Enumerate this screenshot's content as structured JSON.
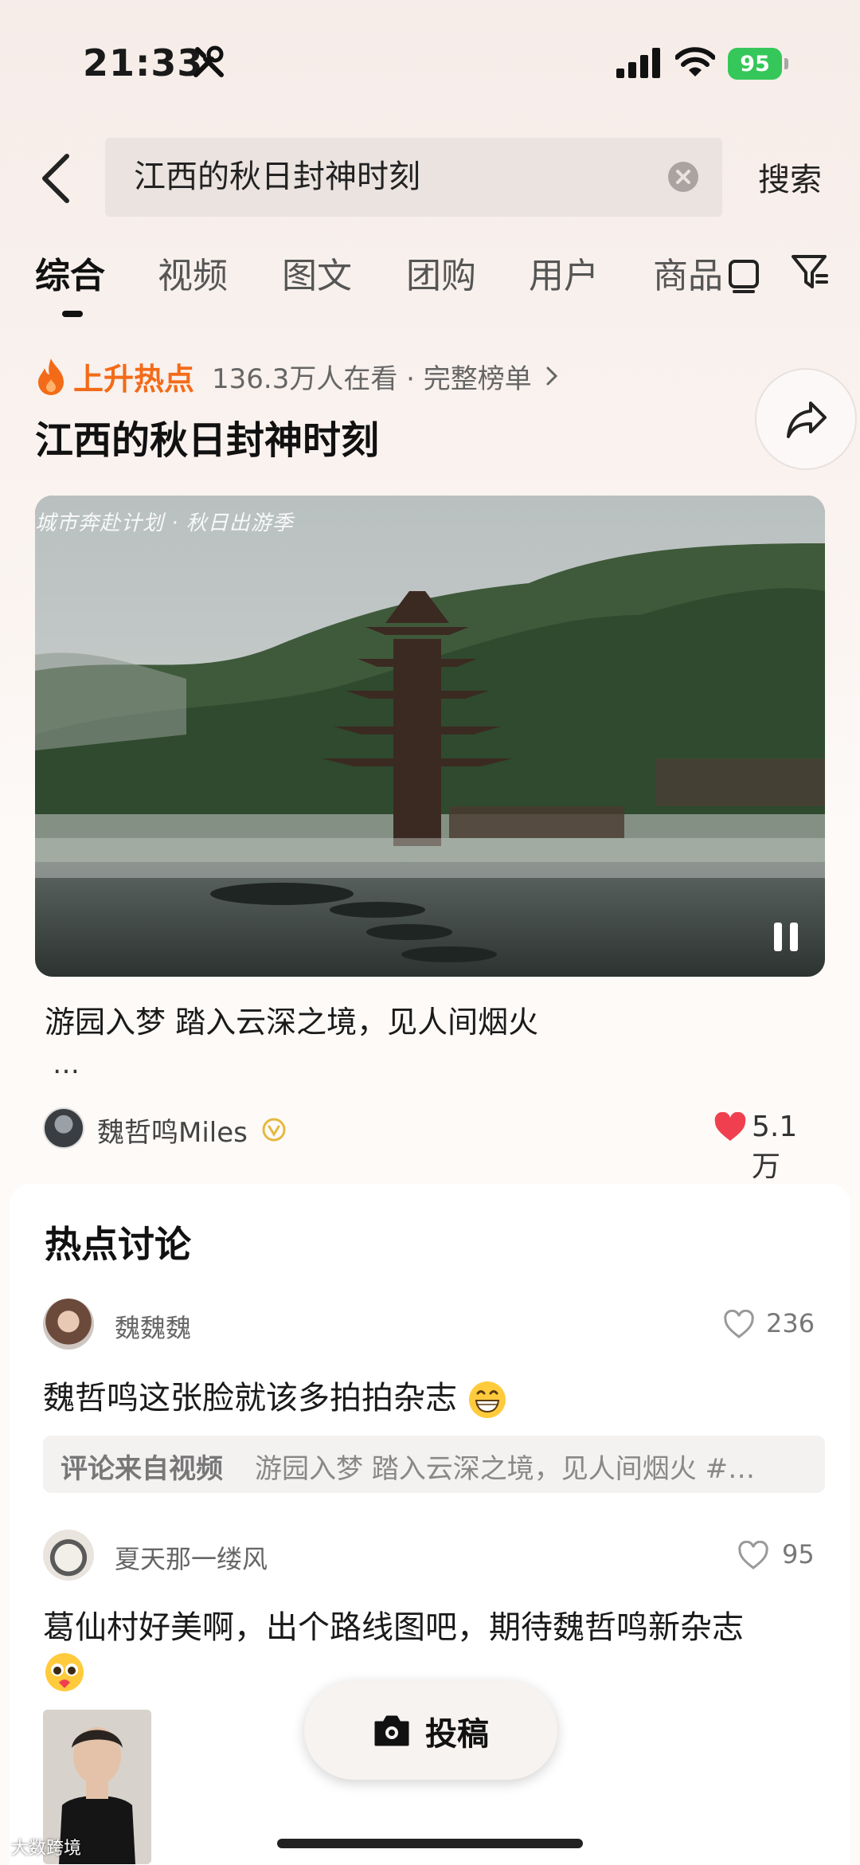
{
  "status_bar": {
    "time": "21:33",
    "battery": "95"
  },
  "search": {
    "query": "江西的秋日封神时刻",
    "button_label": "搜索"
  },
  "tabs": [
    {
      "label": "综合"
    },
    {
      "label": "视频"
    },
    {
      "label": "图文"
    },
    {
      "label": "团购"
    },
    {
      "label": "用户"
    },
    {
      "label": "商品"
    }
  ],
  "hot": {
    "badge": "上升热点",
    "meta": "136.3万人在看 · 完整榜单",
    "title": "江西的秋日封神时刻"
  },
  "video": {
    "watermark": "城市奔赴计划 · 秋日出游季",
    "caption": "游园入梦 踏入云深之境，见人间烟火",
    "ellipsis": "…",
    "author": "魏哲鸣Miles",
    "likes": "5.1万"
  },
  "discussion": {
    "title": "热点讨论",
    "comments": [
      {
        "user": "魏魏魏",
        "likes": "236",
        "text": "魏哲鸣这张脸就该多拍拍杂志",
        "source_label": "评论来自视频",
        "source_text": "游园入梦 踏入云深之境，见人间烟火 #…"
      },
      {
        "user": "夏天那一缕风",
        "likes": "95",
        "text": "葛仙村好美啊，出个路线图吧，期待魏哲鸣新杂志"
      }
    ]
  },
  "post_button": {
    "label": "投稿"
  },
  "watermark": "大数跨境",
  "colors": {
    "accent_orange": "#f36b18",
    "like_red": "#f0404f",
    "battery_green": "#35c759"
  }
}
